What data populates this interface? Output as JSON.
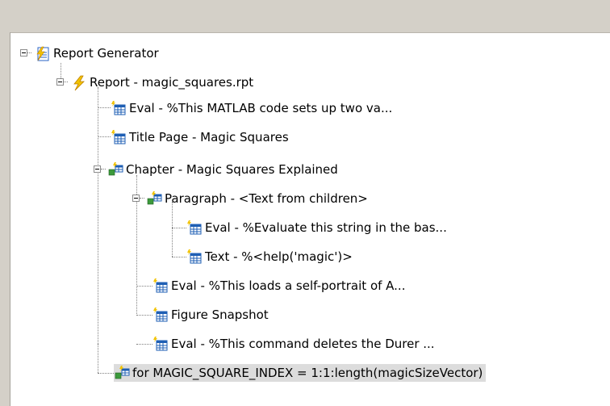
{
  "tree": {
    "root": {
      "label": "Report Generator",
      "icon": "report-generator-icon"
    },
    "report": {
      "label": "Report - magic_squares.rpt",
      "icon": "lightning-icon"
    },
    "eval_setup": {
      "label": "Eval - %This MATLAB code sets up two va...",
      "icon": "component-grid-icon"
    },
    "title_page": {
      "label": "Title Page - Magic Squares",
      "icon": "component-grid-icon"
    },
    "chapter": {
      "label": "Chapter - Magic Squares Explained",
      "icon": "container-component-icon"
    },
    "paragraph": {
      "label": "Paragraph - <Text from children>",
      "icon": "container-component-icon"
    },
    "eval_string": {
      "label": "Eval - %Evaluate this string in the bas...",
      "icon": "component-grid-icon"
    },
    "text_help": {
      "label": "Text - %<help('magic')>",
      "icon": "component-grid-icon"
    },
    "eval_portrait": {
      "label": "Eval - %This loads a self-portrait of A...",
      "icon": "component-grid-icon"
    },
    "figure_snapshot": {
      "label": "Figure Snapshot",
      "icon": "component-grid-icon"
    },
    "eval_delete": {
      "label": "Eval - %This command deletes the Durer ...",
      "icon": "component-grid-icon"
    },
    "for_loop": {
      "label": "for MAGIC_SQUARE_INDEX = 1:1:length(magicSizeVector)",
      "icon": "container-component-icon",
      "selected": true
    }
  },
  "colors": {
    "chrome": "#d4d0c8",
    "selection": "#dcdcdc",
    "icon_blue": "#1f5fb4",
    "icon_yellow": "#f2c300",
    "icon_green": "#3c9a3c"
  }
}
